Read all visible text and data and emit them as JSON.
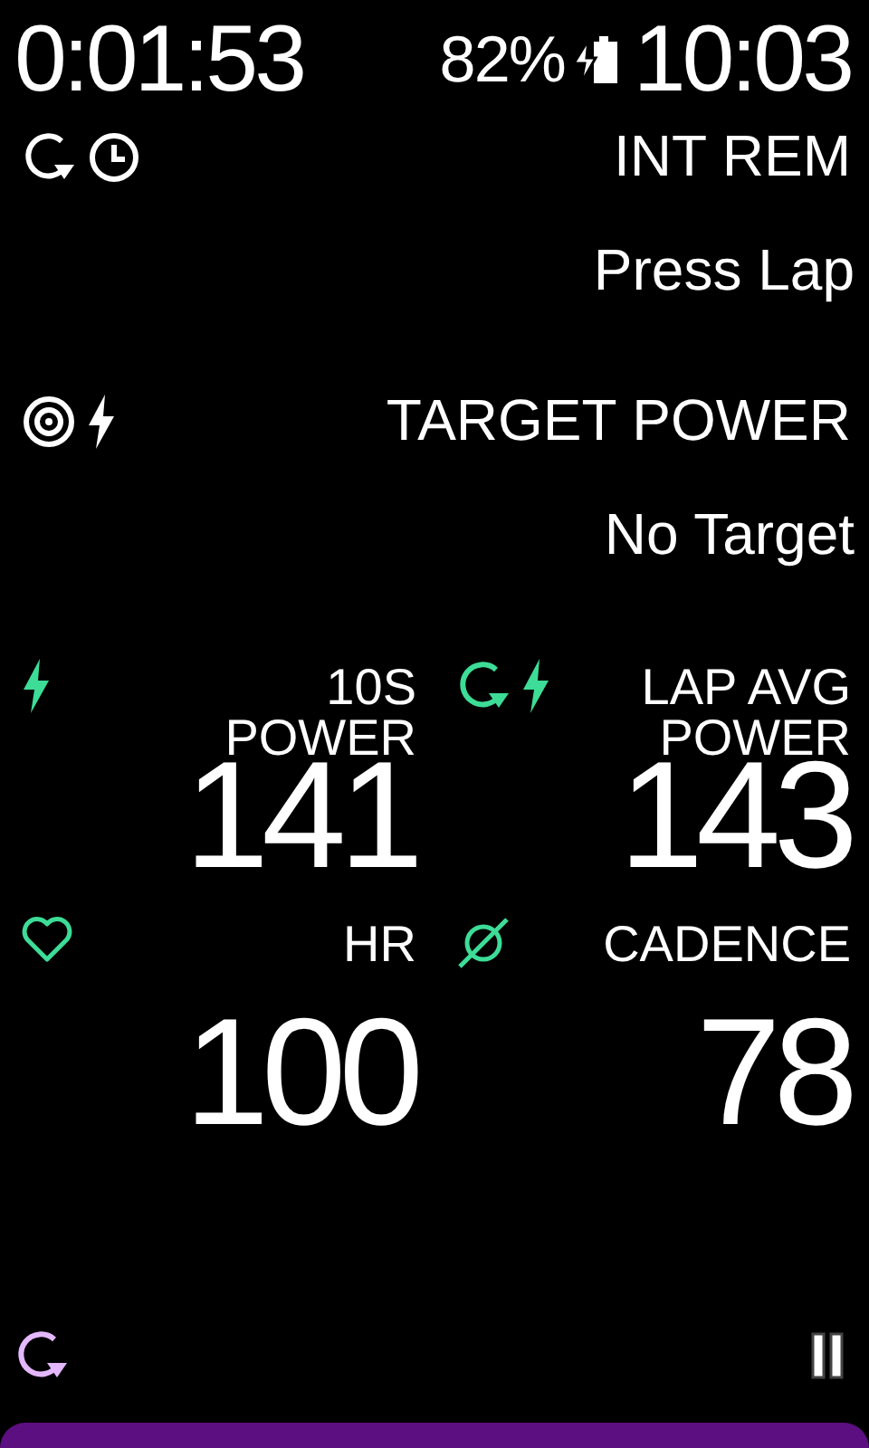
{
  "status_bar": {
    "timer": "0:01:53",
    "battery": "82%",
    "charging": true,
    "clock": "10:03"
  },
  "interval": {
    "label": "INT REM",
    "value": "Press Lap"
  },
  "target": {
    "label": "TARGET POWER",
    "value": "No Target"
  },
  "metrics": [
    {
      "kind": "power",
      "label": "10S POWER",
      "value": "141"
    },
    {
      "kind": "lap_power",
      "label": "LAP AVG POWER",
      "value": "143"
    },
    {
      "kind": "hr",
      "label": "HR",
      "value": "100"
    },
    {
      "kind": "cadence",
      "label": "CADENCE",
      "value": "78"
    }
  ],
  "footer": {
    "paused": true
  }
}
